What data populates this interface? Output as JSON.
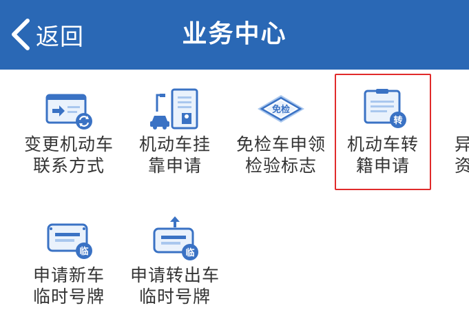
{
  "header": {
    "back_label": "返回",
    "title": "业务中心",
    "bg_color": "#2a68b5"
  },
  "tiles": [
    {
      "icon": "vehicle-contact-card-icon",
      "line1": "变更机动车",
      "line2": "联系方式"
    },
    {
      "icon": "vehicle-affiliation-doc-icon",
      "line1": "机动车挂",
      "line2": "靠申请"
    },
    {
      "icon": "inspection-exempt-badge-icon",
      "badge": "免检",
      "line1": "免检车申领",
      "line2": "检验标志"
    },
    {
      "icon": "vehicle-transfer-doc-icon",
      "badge": "转",
      "line1": "机动车转",
      "line2": "籍申请"
    },
    {
      "icon": "partial-tile-icon",
      "line1": "异",
      "line2": "资"
    },
    {
      "icon": "new-vehicle-temp-plate-icon",
      "badge": "临",
      "line1": "申请新车",
      "line2": "临时号牌"
    },
    {
      "icon": "outbound-temp-plate-icon",
      "badge": "临",
      "line1": "申请转出车",
      "line2": "临时号牌"
    }
  ],
  "colors": {
    "accent": "#2a68b5",
    "icon_blue": "#3a72c4",
    "icon_light": "#a9c7ee",
    "selection_border": "#e02a2a",
    "label_text": "#333333"
  }
}
